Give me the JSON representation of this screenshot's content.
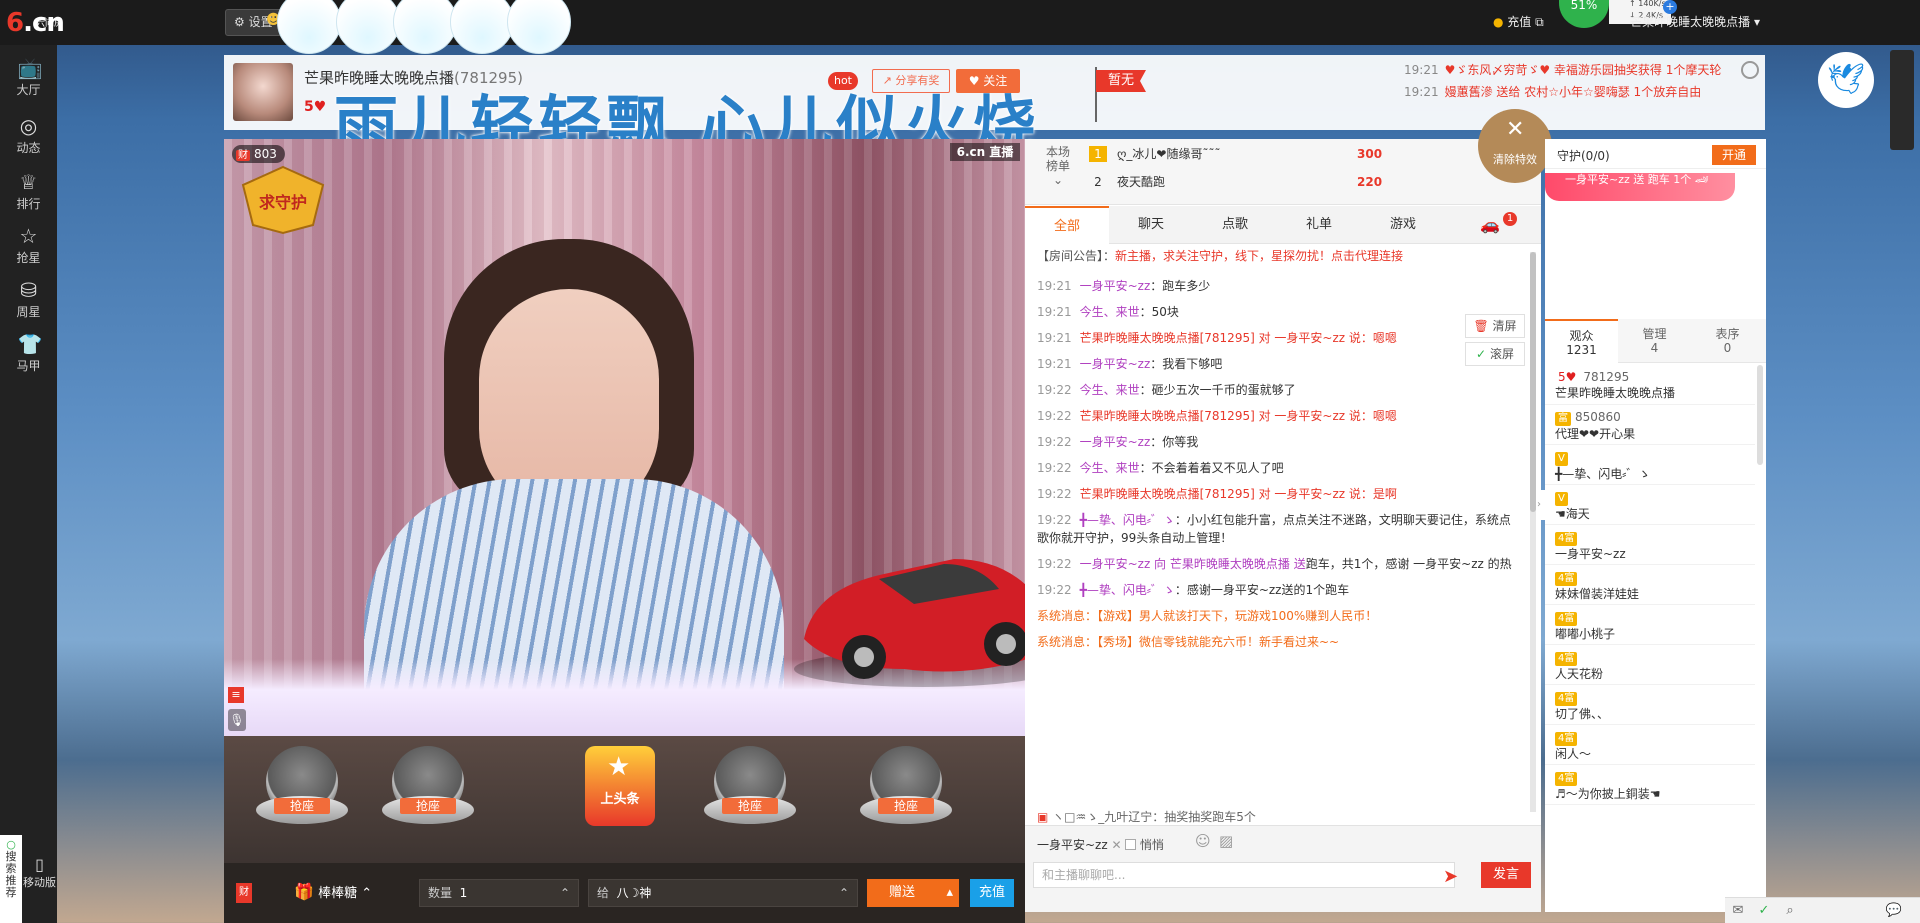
{
  "topbar": {
    "logo": "6.cn",
    "logo_sub": "六间房",
    "settings_label": "设置",
    "recharge_label": "充值",
    "net_percent": "51%",
    "net_up": "140K/s",
    "net_down": "2.4K/s",
    "user_name": "芒果昨晚睡太晚晚点播"
  },
  "sidebar": {
    "items": [
      {
        "label": "大厅",
        "icon": "tv-icon"
      },
      {
        "label": "动态",
        "icon": "compass-icon"
      },
      {
        "label": "排行",
        "icon": "crown-icon"
      },
      {
        "label": "抢星",
        "icon": "star-icon"
      },
      {
        "label": "周星",
        "icon": "gift-box-icon"
      },
      {
        "label": "马甲",
        "icon": "shirt-icon"
      }
    ],
    "recommend": "搜索推荐",
    "mobile": "移动版"
  },
  "header": {
    "room_title": "芒果昨晚睡太晚晚点播",
    "room_id": "(781295)",
    "level": "5♥",
    "hot": "hot",
    "share": "分享有奖",
    "follow": "关注",
    "flag": "暂无",
    "banner_text": "雨儿轻轻飘 心儿似火烧",
    "news": [
      {
        "time": "19:21",
        "text": "♥ゞ东风〆穷苛ゞ♥ 幸福游乐园抽奖获得 1个摩天轮"
      },
      {
        "time": "19:21",
        "text": "嫚蕙舊滲 送给 农村☆小年☆婴嗨瑟 1个放弃自由"
      }
    ]
  },
  "video": {
    "fans": "803",
    "fans_tag": "财",
    "logo": "6.cn 直播",
    "guard": "求守护"
  },
  "seats": {
    "seat_label": "抢座",
    "headline": "上头条"
  },
  "giftbar": {
    "tag": "财",
    "gift_name": "棒棒糖",
    "qty_label": "数量",
    "qty_value": "1",
    "to_label": "给",
    "to_value": "八☽神",
    "send": "赠送",
    "recharge": "充值"
  },
  "rank": {
    "title": "本场榜单",
    "rows": [
      {
        "n": "1",
        "name": "ღ_冰儿❤随缘哥˜˜˜",
        "val": "300"
      },
      {
        "n": "2",
        "name": "夜天酷跑",
        "val": "220"
      }
    ],
    "clear_fx": "清除特效"
  },
  "chat": {
    "tabs": [
      "全部",
      "聊天",
      "点歌",
      "礼单",
      "游戏"
    ],
    "car_badge": "1",
    "notice_prefix": "【房间公告】：",
    "notice": "新主播，求关注守护，线下，星探勿扰！点击代理连接",
    "tools": [
      "清屏",
      "滚屏"
    ],
    "messages": [
      {
        "t": "19:21",
        "u": "一身平安~zz",
        "text": "：跑车多少"
      },
      {
        "t": "19:21",
        "u": "今生、来世",
        "text": "：50块"
      },
      {
        "t": "19:21",
        "u": "芒果昨晚睡太晚晚点播[781295] 对 一身平安~zz 说：",
        "text": "嗯嗯"
      },
      {
        "t": "19:21",
        "u": "一身平安~zz",
        "text": "：我看下够吧"
      },
      {
        "t": "19:22",
        "u": "今生、来世",
        "text": "：砸少五次一千币的蛋就够了"
      },
      {
        "t": "19:22",
        "u": "芒果昨晚睡太晚晚点播[781295] 对 一身平安~zz 说：",
        "text": "嗯嗯"
      },
      {
        "t": "19:22",
        "u": "一身平安~zz",
        "text": "：你等我"
      },
      {
        "t": "19:22",
        "u": "今生、来世",
        "text": "：不会着着着又不见人了吧"
      },
      {
        "t": "19:22",
        "u": "芒果昨晚睡太晚晚点播[781295] 对 一身平安~zz 说：",
        "text": "是啊"
      },
      {
        "t": "19:22",
        "u": "╋—挚、闪电⸗゛ゝ",
        "text": "：小小红包能升富，点点关注不迷路，文明聊天要记住，系统点歌你就开守护，99头条自动上管理！"
      },
      {
        "t": "19:22",
        "u": "一身平安~zz 向 芒果昨晚睡太晚晚点播 送",
        "text": "跑车，共1个，感谢 一身平安~zz 的热"
      },
      {
        "t": "19:22",
        "u": "╋—挚、闪电⸗゛ゝ",
        "text": "：感谢一身平安~zz送的1个跑车"
      }
    ],
    "sys_messages": [
      "系统消息：【游戏】男人就该打天下，玩游戏100%赚到人民币！",
      "系统消息：【秀场】微信零钱就能充六币！新手看过来~~"
    ],
    "ticker": "ヽ□♒ゝ_九叶辽宁：抽奖抽奖跑车5个",
    "to_user": "一身平安~zz",
    "whisper": "悄悄",
    "input_placeholder": "和主播聊聊吧...",
    "send": "发言"
  },
  "right": {
    "guard_label": "守护(0/0)",
    "open": "开通",
    "race_text": "一身平安~zz 送 跑车 1个",
    "tabs": [
      {
        "label": "观众",
        "count": "1231"
      },
      {
        "label": "管理",
        "count": "4"
      },
      {
        "label": "表序",
        "count": "0"
      }
    ],
    "audience": [
      {
        "lv": "5♥",
        "id": "781295",
        "name": "芒果昨晚睡太晚晚点播"
      },
      {
        "lv": "富",
        "id": "850860",
        "name": "代理❤❤开心果"
      },
      {
        "lv": "V",
        "id": "",
        "name": "╋—挚、闪电⸗゛ゝ"
      },
      {
        "lv": "V",
        "id": "",
        "name": "☚海天"
      },
      {
        "lv": "4富",
        "id": "",
        "name": "一身平安~zz"
      },
      {
        "lv": "4富",
        "id": "",
        "name": "妹妹僧装洋娃娃"
      },
      {
        "lv": "4富",
        "id": "",
        "name": "嘟嘟小桃子"
      },
      {
        "lv": "4富",
        "id": "",
        "name": "人天花粉"
      },
      {
        "lv": "4富",
        "id": "",
        "name": "切了佛、、"
      },
      {
        "lv": "4富",
        "id": "",
        "name": "闲人～"
      },
      {
        "lv": "4富",
        "id": "",
        "name": "♬～为你披上銅装☚"
      }
    ]
  },
  "colors": {
    "accent": "#f26c1a",
    "brand_red": "#e8382a",
    "blue": "#1aa0e8"
  }
}
